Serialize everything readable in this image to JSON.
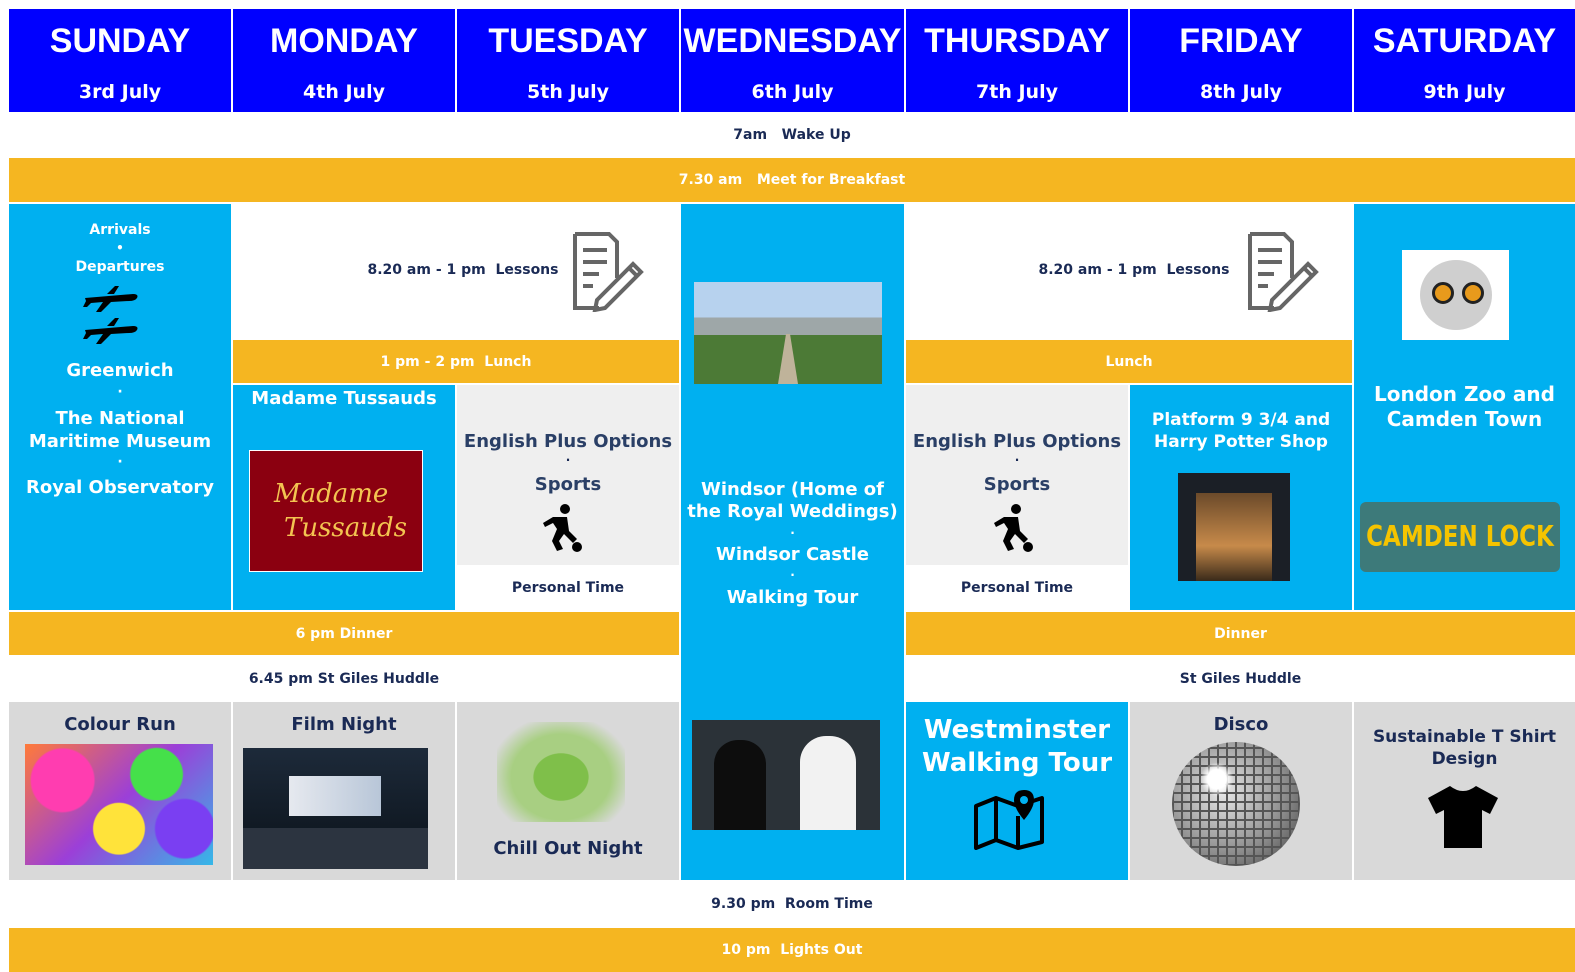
{
  "days": [
    {
      "name": "SUNDAY",
      "date": "3rd July"
    },
    {
      "name": "MONDAY",
      "date": "4th July"
    },
    {
      "name": "TUESDAY",
      "date": "5th July"
    },
    {
      "name": "WEDNESDAY",
      "date": "6th July"
    },
    {
      "name": "THURSDAY",
      "date": "7th July"
    },
    {
      "name": "FRIDAY",
      "date": "8th July"
    },
    {
      "name": "SATURDAY",
      "date": "9th July"
    }
  ],
  "rows": {
    "wake_up": "7am   Wake Up",
    "breakfast": "7.30 am   Meet for Breakfast",
    "room_time": "9.30 pm  Room Time",
    "lights_out": "10 pm  Lights Out"
  },
  "sunday": {
    "arrivals": "Arrivals",
    "bullet": "•",
    "departures": "Departures",
    "greenwich": "Greenwich",
    "dot": "·",
    "museum": "The National Maritime Museum",
    "observatory": "Royal Observatory",
    "evening": "Colour Run"
  },
  "mon_tue": {
    "lessons": "8.20 am - 1 pm  Lessons",
    "lunch": "1 pm - 2 pm  Lunch",
    "mon_activity": "Madame Tussauds",
    "logo_line1": "Madame",
    "logo_line2": "Tussauds",
    "tue_options": "English Plus Options",
    "tue_sports": "Sports",
    "personal_time": "Personal Time",
    "dinner": "6 pm Dinner",
    "huddle": "6.45 pm St Giles Huddle",
    "mon_evening": "Film Night",
    "tue_evening": "Chill Out Night"
  },
  "wednesday": {
    "title": "Windsor (Home of the Royal Weddings)",
    "castle": "Windsor Castle",
    "tour": "Walking Tour",
    "dot": "·"
  },
  "thu_fri": {
    "lessons": "8.20 am - 1 pm  Lessons",
    "lunch": "Lunch",
    "thu_options": "English Plus Options",
    "thu_sports": "Sports",
    "personal_time": "Personal Time",
    "fri_activity": "Platform 9 3/4 and Harry Potter Shop",
    "dinner": "Dinner",
    "huddle": "St Giles Huddle",
    "thu_evening": "Westminster Walking Tour",
    "fri_evening": "Disco"
  },
  "saturday": {
    "activity": "London Zoo and Camden Town",
    "sign": "CAMDEN LOCK",
    "evening": "Sustainable T Shirt Design"
  },
  "colors": {
    "header_blue": "#0000ff",
    "sky_blue": "#00b0f0",
    "orange": "#f5b621",
    "navy": "#1a2a55",
    "light_grey": "#efefef",
    "grey": "#d9d9d9"
  }
}
